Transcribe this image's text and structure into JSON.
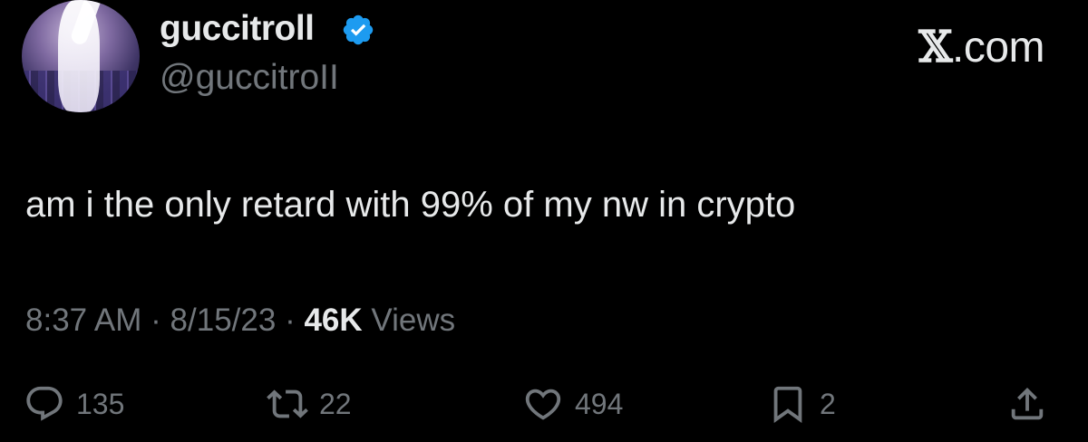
{
  "author": {
    "display_name": "guccitroll",
    "handle": "@guccitroII",
    "verified": true,
    "badge_color": "#1d9bf0"
  },
  "brand": {
    "text": ".com",
    "icon": "x-logo-icon"
  },
  "tweet": {
    "text": "am i the only retard with 99% of my nw in crypto"
  },
  "meta": {
    "time": "8:37 AM",
    "separator": "·",
    "date": "8/15/23",
    "views_count": "46K",
    "views_label": "Views"
  },
  "actions": {
    "replies": "135",
    "reposts": "22",
    "likes": "494",
    "bookmarks": "2"
  },
  "colors": {
    "background": "#000000",
    "primary_text": "#e7e9ea",
    "secondary_text": "#71767b"
  }
}
